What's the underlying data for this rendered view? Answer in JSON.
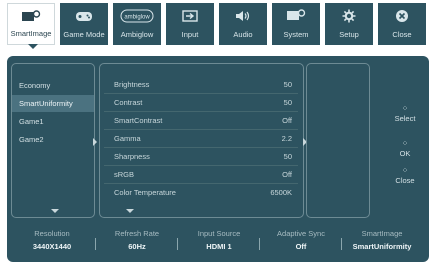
{
  "tabs": [
    {
      "label": "SmartImage",
      "icon": "smartimage-icon",
      "glyph": "▭⚙",
      "active": true
    },
    {
      "label": "Game Mode",
      "icon": "gamepad-icon",
      "glyph": "🎮",
      "active": false
    },
    {
      "label": "Ambiglow",
      "icon": "ambiglow-icon",
      "glyph": "◯",
      "active": false
    },
    {
      "label": "Input",
      "icon": "input-icon",
      "glyph": "⮕",
      "active": false
    },
    {
      "label": "Audio",
      "icon": "speaker-icon",
      "glyph": "🔊",
      "active": false
    },
    {
      "label": "System",
      "icon": "system-icon",
      "glyph": "▭⚙",
      "active": false
    },
    {
      "label": "Setup",
      "icon": "gear-icon",
      "glyph": "⚙",
      "active": false
    },
    {
      "label": "Close",
      "icon": "close-icon",
      "glyph": "✖",
      "active": false
    }
  ],
  "ambiglow_logo_text": "ambiglow",
  "modes": [
    "Economy",
    "SmartUniformity",
    "Game1",
    "Game2"
  ],
  "selected_mode": "SmartUniformity",
  "settings": [
    {
      "name": "Brightness",
      "value": "50"
    },
    {
      "name": "Contrast",
      "value": "50"
    },
    {
      "name": "SmartContrast",
      "value": "Off"
    },
    {
      "name": "Gamma",
      "value": "2.2"
    },
    {
      "name": "Sharpness",
      "value": "50"
    },
    {
      "name": "sRGB",
      "value": "Off"
    },
    {
      "name": "Color Temperature",
      "value": "6500K"
    }
  ],
  "nav": {
    "select": "Select",
    "ok": "OK",
    "close": "Close"
  },
  "status": [
    {
      "label": "Resolution",
      "value": "3440X1440"
    },
    {
      "label": "Refresh Rate",
      "value": "60Hz"
    },
    {
      "label": "Input Source",
      "value": "HDMI 1"
    },
    {
      "label": "Adaptive Sync",
      "value": "Off"
    },
    {
      "label": "SmartImage",
      "value": "SmartUniformity"
    }
  ],
  "colors": {
    "panel": "#2d5360",
    "highlight": "#4b7280",
    "text": "#d3e0e4"
  }
}
